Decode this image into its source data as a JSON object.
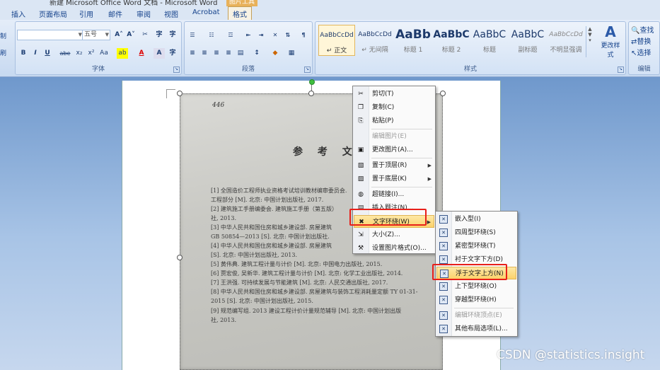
{
  "window": {
    "title": "新建 Microsoft Office Word 文档 - Microsoft Word",
    "context_tab_header": "图片工具"
  },
  "tabs": [
    "插入",
    "页面布局",
    "引用",
    "邮件",
    "审阅",
    "视图",
    "Acrobat",
    "格式"
  ],
  "ribbon": {
    "font_group": {
      "label": "字体",
      "font_size": "五号",
      "left_cut_labels": [
        "制",
        "刷"
      ],
      "buttons_row1": [
        "A˄",
        "A˅",
        "✂",
        "字",
        "字"
      ],
      "buttons_row2": [
        "B",
        "I",
        "U",
        "abe",
        "x₂",
        "x²",
        "Aa",
        "ab",
        "A",
        "A",
        "字"
      ]
    },
    "paragraph_group": {
      "label": "段落"
    },
    "styles_group": {
      "label": "样式",
      "styles": [
        {
          "preview": "AaBbCcDd",
          "name": "正文",
          "selected": true
        },
        {
          "preview": "AaBbCcDd",
          "name": "无间隔"
        },
        {
          "preview": "AaBb",
          "name": "标题 1"
        },
        {
          "preview": "AaBbC",
          "name": "标题 2"
        },
        {
          "preview": "AaBbC",
          "name": "标题"
        },
        {
          "preview": "AaBbC",
          "name": "副标题"
        },
        {
          "preview": "AaBbCcDd",
          "name": "不明显强调"
        }
      ],
      "change_styles": "更改样式"
    },
    "editing_group": {
      "label": "编辑",
      "find": "查找",
      "replace": "替换",
      "select": "选择"
    }
  },
  "document": {
    "page_number": "446",
    "heading": "参 考 文 献",
    "references": [
      "[1] 全国造价工程师执业资格考试培训教材编审委员会.",
      "    工程部分 [M]. 北京: 中国计划出版社, 2017.",
      "[2] 建筑施工手册编委会. 建筑施工手册（第五版）",
      "    社, 2013.",
      "[3] 中华人民共和国住房和城乡建设部. 房屋建筑",
      "    GB 50854—2013 [S]. 北京: 中国计划出版社.",
      "[4] 中华人民共和国住房和城乡建设部. 房屋建筑",
      "    [S]. 北京: 中国计划出版社, 2013.",
      "[5] 黄伟典. 建筑工程计量与计价 [M]. 北京: 中国电力出版社, 2015.",
      "[6] 贾宏俊, 吴新华. 建筑工程计量与计价 [M]. 北京: 化学工业出版社, 2014.",
      "[7] 王洪强. 可持续发展与节能建筑 [M]. 北京: 人民交通出版社, 2017.",
      "[8] 中华人民共和国住房和城乡建设部. 房屋建筑与装饰工程消耗量定额 TY 01-31-",
      "    2015 [S]. 北京: 中国计划出版社, 2015.",
      "[9] 规范编写组. 2013 建设工程计价计量规范辅导 [M]. 北京: 中国计划出版",
      "    社, 2013."
    ]
  },
  "context_menu": [
    {
      "icon": "scissors-icon",
      "glyph": "✂",
      "label": "剪切(T)"
    },
    {
      "icon": "copy-icon",
      "glyph": "❐",
      "label": "复制(C)"
    },
    {
      "icon": "paste-icon",
      "glyph": "⎘",
      "label": "粘贴(P)"
    },
    {
      "sep": true
    },
    {
      "icon": "edit-picture-icon",
      "glyph": "",
      "label": "编辑图片(E)",
      "disabled": true
    },
    {
      "icon": "change-picture-icon",
      "glyph": "▣",
      "label": "更改图片(A)..."
    },
    {
      "sep": true
    },
    {
      "icon": "bring-front-icon",
      "glyph": "▧",
      "label": "置于顶层(R)",
      "submenu": true
    },
    {
      "icon": "send-back-icon",
      "glyph": "▨",
      "label": "置于底层(K)",
      "submenu": true
    },
    {
      "sep": true
    },
    {
      "icon": "hyperlink-icon",
      "glyph": "◍",
      "label": "超链接(I)..."
    },
    {
      "icon": "caption-icon",
      "glyph": "▤",
      "label": "插入题注(N)..."
    },
    {
      "icon": "wrap-text-icon",
      "glyph": "✖",
      "label": "文字环绕(W)",
      "submenu": true,
      "highlight": true
    },
    {
      "icon": "size-icon",
      "glyph": "⇲",
      "label": "大小(Z)..."
    },
    {
      "icon": "format-picture-icon",
      "glyph": "⚒",
      "label": "设置图片格式(O)..."
    }
  ],
  "wrap_submenu": [
    {
      "icon": "inline-icon",
      "label": "嵌入型(I)"
    },
    {
      "icon": "square-wrap-icon",
      "label": "四周型环绕(S)"
    },
    {
      "icon": "tight-wrap-icon",
      "label": "紧密型环绕(T)"
    },
    {
      "icon": "behind-text-icon",
      "label": "衬于文字下方(D)"
    },
    {
      "icon": "in-front-text-icon",
      "label": "浮于文字上方(N)",
      "highlight": true
    },
    {
      "icon": "top-bottom-icon",
      "label": "上下型环绕(O)"
    },
    {
      "icon": "through-wrap-icon",
      "label": "穿越型环绕(H)"
    },
    {
      "icon": "edit-wrap-points-icon",
      "label": "编辑环绕顶点(E)",
      "disabled": true
    },
    {
      "icon": "more-layout-icon",
      "label": "其他布局选项(L)..."
    }
  ],
  "watermark": "CSDN @statistics.insight"
}
